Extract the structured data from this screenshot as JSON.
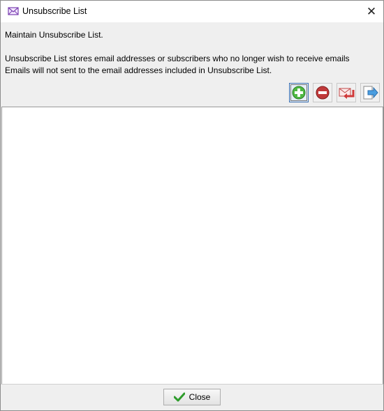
{
  "window": {
    "title": "Unsubscribe List",
    "close_glyph": "✕"
  },
  "info": {
    "heading": "Maintain Unsubscribe List.",
    "line1": "Unsubscribe List stores email addresses or subscribers who no longer wish to receive emails",
    "line2": "Emails will not sent to the email addresses included in Unsubscribe List."
  },
  "toolbar": {
    "buttons": [
      {
        "icon": "add-icon"
      },
      {
        "icon": "remove-icon"
      },
      {
        "icon": "import-icon"
      },
      {
        "icon": "export-icon"
      }
    ]
  },
  "unsubscribe_list": {
    "items": []
  },
  "footer": {
    "close_label": "Close",
    "close_icon": "checkmark-icon"
  },
  "colors": {
    "add": "#3aa12e",
    "remove": "#b0302d",
    "import": "#d03a3a",
    "export": "#3a8fd6",
    "checkmark": "#2e9c2b"
  }
}
